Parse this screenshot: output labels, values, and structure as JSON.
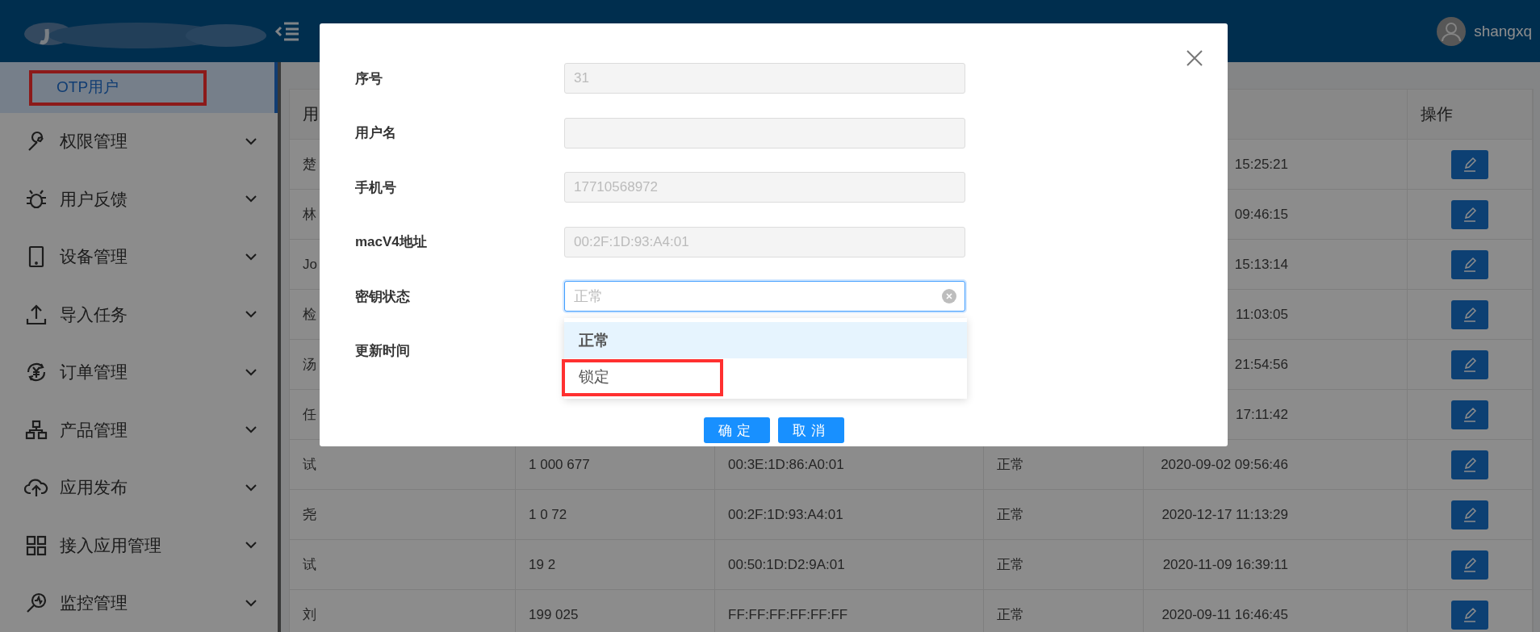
{
  "header": {
    "user": "shangxq"
  },
  "sidebar": {
    "items": [
      {
        "label": "OTP用户",
        "selected": true,
        "highlighted": true,
        "kind": "sub"
      },
      {
        "label": "权限管理",
        "selected": false,
        "kind": "group"
      },
      {
        "label": "用户反馈",
        "selected": false,
        "kind": "group"
      },
      {
        "label": "设备管理",
        "selected": false,
        "kind": "group"
      },
      {
        "label": "导入任务",
        "selected": false,
        "kind": "group"
      },
      {
        "label": "订单管理",
        "selected": false,
        "kind": "group"
      },
      {
        "label": "产品管理",
        "selected": false,
        "kind": "group"
      },
      {
        "label": "应用发布",
        "selected": false,
        "kind": "group"
      },
      {
        "label": "接入应用管理",
        "selected": false,
        "kind": "group"
      },
      {
        "label": "监控管理",
        "selected": false,
        "kind": "group"
      }
    ]
  },
  "table": {
    "header": {
      "column_1": "用",
      "column_6": "操作"
    },
    "rows": [
      {
        "name": "楚",
        "time": "15:25:21"
      },
      {
        "name": "林",
        "time": "09:46:15"
      },
      {
        "name": "Jo",
        "time": "15:13:14"
      },
      {
        "name": "检",
        "time": "11:03:05"
      },
      {
        "name": "汤",
        "time": "21:54:56"
      },
      {
        "name": "任",
        "time": "17:11:42"
      },
      {
        "name": "试",
        "phone": "1 000 677",
        "mac": "00:3E:1D:86:A0:01",
        "status": "正常",
        "time": "2020-09-02 09:56:46"
      },
      {
        "name": "尧",
        "phone": "1 0 72",
        "mac": "00:2F:1D:93:A4:01",
        "status": "正常",
        "time": "2020-12-17 11:13:29"
      },
      {
        "name": "试",
        "phone": "19 2",
        "mac": "00:50:1D:D2:9A:01",
        "status": "正常",
        "time": "2020-11-09 16:39:11"
      },
      {
        "name": "刘",
        "phone": "199 025",
        "mac": "FF:FF:FF:FF:FF:FF",
        "status": "正常",
        "time": "2020-09-11 16:46:45"
      }
    ]
  },
  "dialog": {
    "fields": [
      {
        "label": "序号",
        "kind": "input",
        "value": "31"
      },
      {
        "label": "用户名",
        "kind": "input"
      },
      {
        "label": "手机号",
        "kind": "input",
        "value": "17710568972"
      },
      {
        "label": "macV4地址",
        "kind": "input",
        "value": "00:2F:1D:93:A4:01"
      },
      {
        "label": "密钥状态",
        "kind": "select",
        "placeholder": "正常",
        "options": [
          {
            "label": "正常",
            "selected": true,
            "highlighted": false
          },
          {
            "label": "锁定",
            "selected": false,
            "highlighted": true
          }
        ]
      },
      {
        "label": "更新时间",
        "kind": "hidden"
      }
    ],
    "buttons": [
      "确定",
      "取消"
    ]
  }
}
